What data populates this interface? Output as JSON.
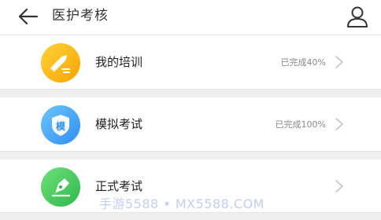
{
  "header": {
    "title": "医护考核",
    "back_icon": "arrow-left-icon",
    "user_icon": "user-icon"
  },
  "items": [
    {
      "label": "我的培训",
      "status": "已完成40%",
      "progress_percent": 40,
      "icon": "pencil-icon",
      "icon_color": "#f8b400"
    },
    {
      "label": "模拟考试",
      "status": "已完成100%",
      "progress_percent": 100,
      "icon": "shield-icon",
      "icon_glyph": "模",
      "icon_color": "#3b9cf2"
    },
    {
      "label": "正式考试",
      "status": "",
      "icon": "pen-nib-icon",
      "icon_color": "#3cc35a"
    }
  ],
  "watermark": "手游5588 • MX5588.COM",
  "colors": {
    "separator": "#efefef",
    "title_text": "#333333",
    "status_text": "#888888"
  }
}
